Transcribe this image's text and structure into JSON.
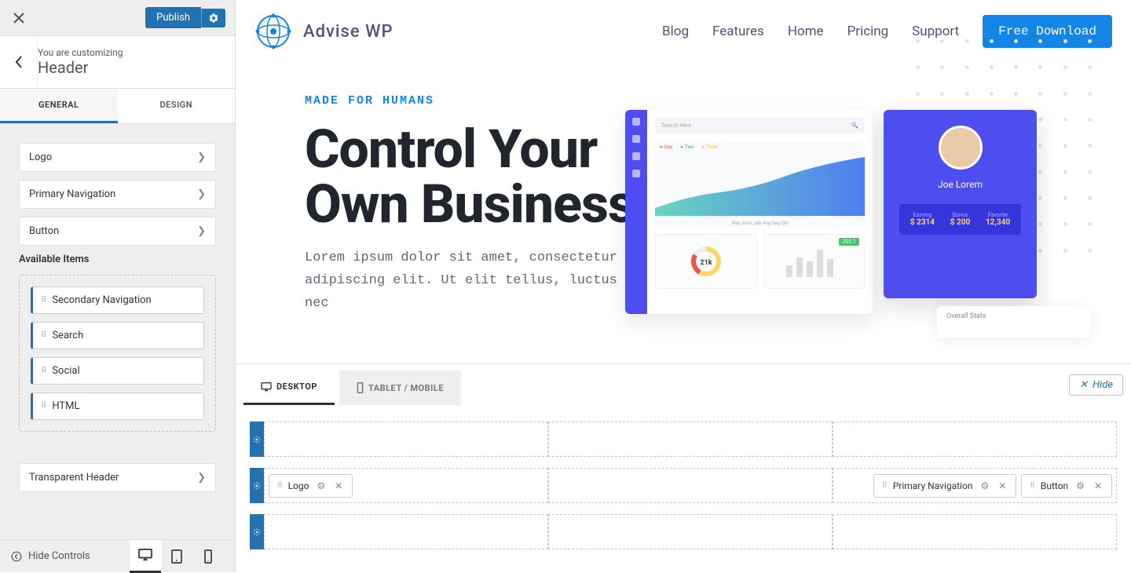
{
  "sidebar": {
    "publish_label": "Publish",
    "customizing_label": "You are customizing",
    "section_title": "Header",
    "tabs": {
      "general": "GENERAL",
      "design": "DESIGN"
    },
    "items": [
      {
        "label": "Logo"
      },
      {
        "label": "Primary Navigation"
      },
      {
        "label": "Button"
      }
    ],
    "available_label": "Available Items",
    "available_items": [
      {
        "label": "Secondary Navigation"
      },
      {
        "label": "Search"
      },
      {
        "label": "Social"
      },
      {
        "label": "HTML"
      }
    ],
    "transparent_label": "Transparent Header",
    "hide_controls": "Hide Controls"
  },
  "preview": {
    "brand": "Advise WP",
    "nav": [
      "Blog",
      "Features",
      "Home",
      "Pricing",
      "Support"
    ],
    "cta": "Free Download",
    "hero_tag": "MADE FOR HUMANS",
    "hero_title": "Control Your Own Business",
    "hero_desc": "Lorem ipsum dolor sit amet, consectetur adipiscing elit. Ut elit tellus, luctus nec",
    "dash": {
      "search": "Search Here",
      "months": "May   June   July   Aug   Sep   Oct",
      "pie_val": "21k",
      "pie_badge": "205.1"
    },
    "profile": {
      "name": "Joe Lorem",
      "stats": [
        {
          "label": "Earning",
          "value": "$ 2314"
        },
        {
          "label": "Bonus",
          "value": "$ 200"
        },
        {
          "label": "Favorite",
          "value": "12,340"
        }
      ],
      "overall": "Overall Stats"
    }
  },
  "builder": {
    "tabs": {
      "desktop": "DESKTOP",
      "mobile": "TABLET / MOBILE"
    },
    "hide": "Hide",
    "chips": {
      "logo": "Logo",
      "primary_nav": "Primary Navigation",
      "button": "Button"
    }
  }
}
